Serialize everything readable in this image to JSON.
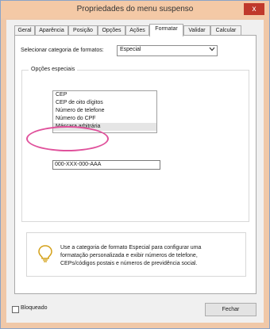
{
  "window": {
    "title": "Propriedades do menu suspenso",
    "close_glyph": "x"
  },
  "tabs": [
    {
      "label": "Geral"
    },
    {
      "label": "Aparência"
    },
    {
      "label": "Posição"
    },
    {
      "label": "Opções"
    },
    {
      "label": "Ações"
    },
    {
      "label": "Formatar"
    },
    {
      "label": "Validar"
    },
    {
      "label": "Calcular"
    }
  ],
  "active_tab": "Formatar",
  "format": {
    "category_label": "Selecionar categoria de formatos:",
    "category_value": "Especial",
    "dropdown_icon": "chevron-down-icon"
  },
  "special": {
    "group_label": "Opções especiais",
    "items": [
      "CEP",
      "CEP de oito dígitos",
      "Número de telefone",
      "Número do CPF",
      "Máscara arbitrária"
    ],
    "selected_item": "Máscara arbitrária",
    "mask_value": "000-XXX-000-AAA"
  },
  "info": {
    "icon": "lightbulb-icon",
    "lines": [
      "Use a categoria de formato Especial para configurar uma",
      "formatação personalizada e exibir números de telefone,",
      "CEPs/códigos postais e números de previdência social."
    ]
  },
  "footer": {
    "locked_label": "Bloqueado",
    "close_label": "Fechar"
  },
  "colors": {
    "highlight": "#e0529c",
    "titlebar": "#f4c9a6",
    "close": "#c0392b"
  }
}
